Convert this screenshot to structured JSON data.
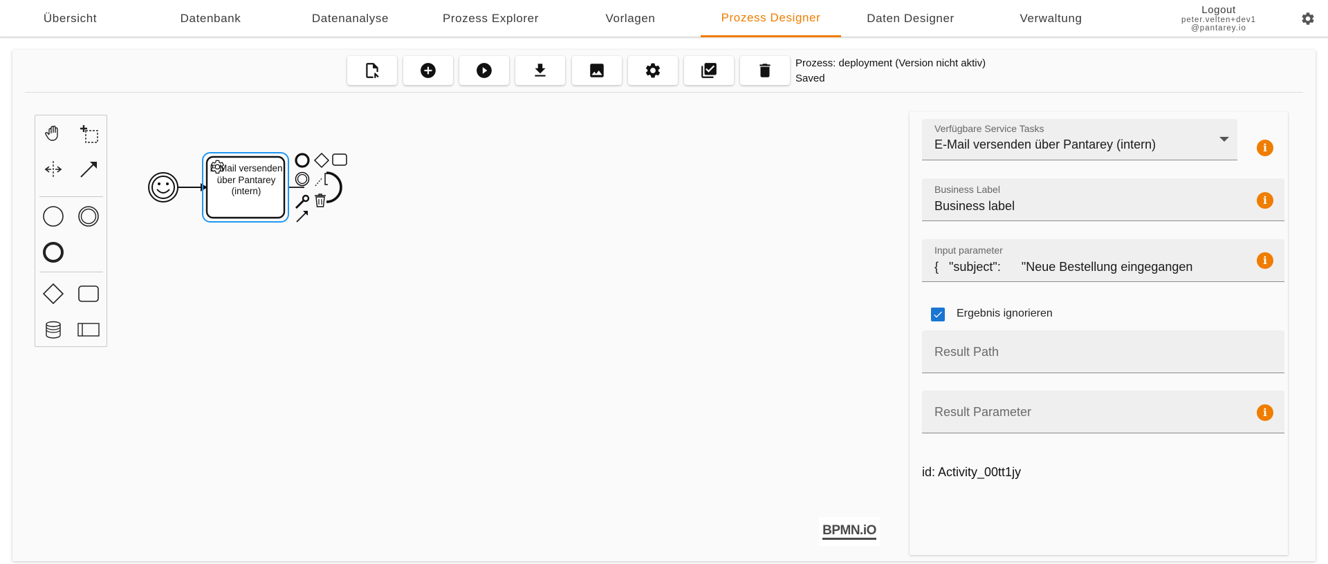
{
  "nav": {
    "tabs": [
      "Übersicht",
      "Datenbank",
      "Datenanalyse",
      "Prozess Explorer",
      "Vorlagen",
      "Prozess Designer",
      "Daten Designer",
      "Verwaltung"
    ],
    "active_tab": "Prozess Designer",
    "logout_label": "Logout",
    "user_line1": "peter.velten+dev1",
    "user_line2": "@pantarey.io"
  },
  "toolbar": {
    "buttons": [
      "file-export-icon",
      "add-circle-icon",
      "play-circle-icon",
      "download-icon",
      "image-icon",
      "settings-icon",
      "checklist-icon",
      "delete-icon"
    ],
    "process_label": "Prozess: deployment (Version nicht aktiv)",
    "status": "Saved"
  },
  "diagram": {
    "task_label": "E-Mail versenden über Pantarey (intern)",
    "logo_text": "BPMN.iO"
  },
  "properties": {
    "service_tasks": {
      "label": "Verfügbare Service Tasks",
      "value": "E-Mail versenden über Pantarey (intern)"
    },
    "business_label": {
      "label": "Business Label",
      "value": "Business label"
    },
    "input_parameter": {
      "label": "Input parameter",
      "value": "{   \"subject\":      \"Neue Bestellung eingegangen"
    },
    "ignore_result": {
      "label": "Ergebnis ignorieren",
      "checked": true
    },
    "result_path": {
      "placeholder": "Result Path"
    },
    "result_parameter": {
      "placeholder": "Result Parameter"
    },
    "id_text": "id: Activity_00tt1jy"
  },
  "colors": {
    "accent": "#ef7d00",
    "checkbox": "#1976d2",
    "selection": "#2196f3"
  }
}
